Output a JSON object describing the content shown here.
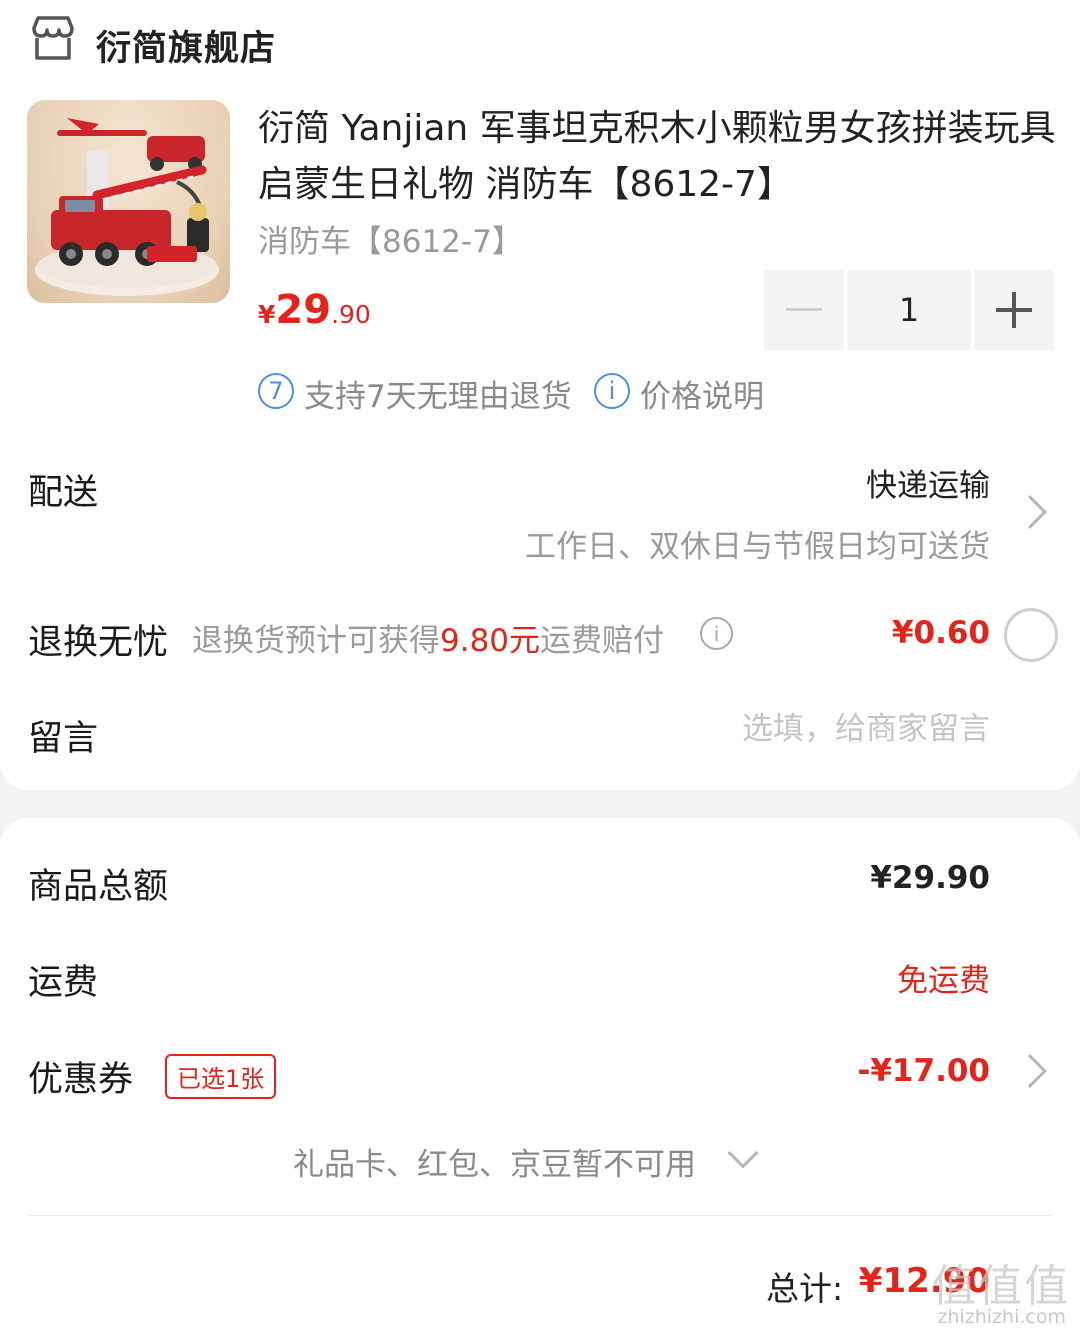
{
  "store": {
    "name": "衍简旗舰店",
    "icon": "store-icon"
  },
  "product": {
    "title": "衍简 Yanjian 军事坦克积木小颗粒男女孩拼装玩具启蒙生日礼物 消防车【8612-7】",
    "spec": "消防车【8612-7】",
    "price_symbol": "¥",
    "price_int": "29",
    "price_dec": ".90",
    "quantity": "1",
    "services": [
      {
        "badge": "7",
        "text": "支持7天无理由退货"
      },
      {
        "badge": "i",
        "text": "价格说明"
      }
    ]
  },
  "delivery": {
    "label": "配送",
    "mode": "快递运输",
    "note": "工作日、双休日与节假日均可送货"
  },
  "returns": {
    "label": "退换无忧",
    "desc_prefix": "退换货预计可获得",
    "desc_highlight": "9.80元",
    "desc_suffix": "运费赔付",
    "price": "¥0.60"
  },
  "message": {
    "label": "留言",
    "placeholder": "选填，给商家留言"
  },
  "summary": {
    "subtotal_label": "商品总额",
    "subtotal_value": "¥29.90",
    "shipping_label": "运费",
    "shipping_value": "免运费",
    "coupon_label": "优惠券",
    "coupon_badge": "已选1张",
    "coupon_value": "-¥17.00",
    "gift_note": "礼品卡、红包、京豆暂不可用",
    "total_label": "总计:",
    "total_value": "¥12.90"
  },
  "watermark": {
    "text": "值值值",
    "url": "zhizhizhi.com"
  },
  "colors": {
    "accent": "#e1251b",
    "info_blue": "#4d8fe0"
  }
}
